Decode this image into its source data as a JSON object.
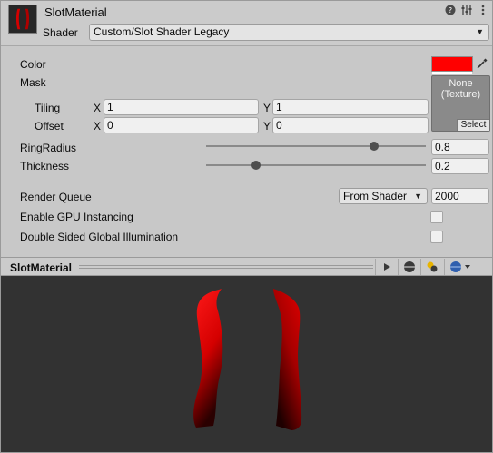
{
  "header": {
    "material_name": "SlotMaterial",
    "shader_label": "Shader",
    "shader_value": "Custom/Slot Shader Legacy",
    "icons": [
      "help-icon",
      "preset-icon",
      "more-options-icon"
    ]
  },
  "properties": {
    "color_label": "Color",
    "color_value": "#ff0000",
    "mask_label": "Mask",
    "mask_texture_text": "None\n(Texture)",
    "mask_select_label": "Select",
    "tiling_label": "Tiling",
    "offset_label": "Offset",
    "x_label": "X",
    "y_label": "Y",
    "tiling_x": "1",
    "tiling_y": "1",
    "offset_x": "0",
    "offset_y": "0",
    "ring_radius_label": "RingRadius",
    "ring_radius_value": "0.8",
    "ring_radius_fraction": 0.8,
    "thickness_label": "Thickness",
    "thickness_value": "0.2",
    "thickness_fraction": 0.2,
    "render_queue_label": "Render Queue",
    "render_queue_mode": "From Shader",
    "render_queue_value": "2000",
    "gpu_instancing_label": "Enable GPU Instancing",
    "gpu_instancing_checked": false,
    "double_sided_gi_label": "Double Sided Global Illumination",
    "double_sided_gi_checked": false
  },
  "preview": {
    "title": "SlotMaterial",
    "buttons": [
      "play-icon",
      "sphere-shape-icon",
      "lighting-icon",
      "background-sphere-icon"
    ],
    "background_color": "#323232"
  }
}
